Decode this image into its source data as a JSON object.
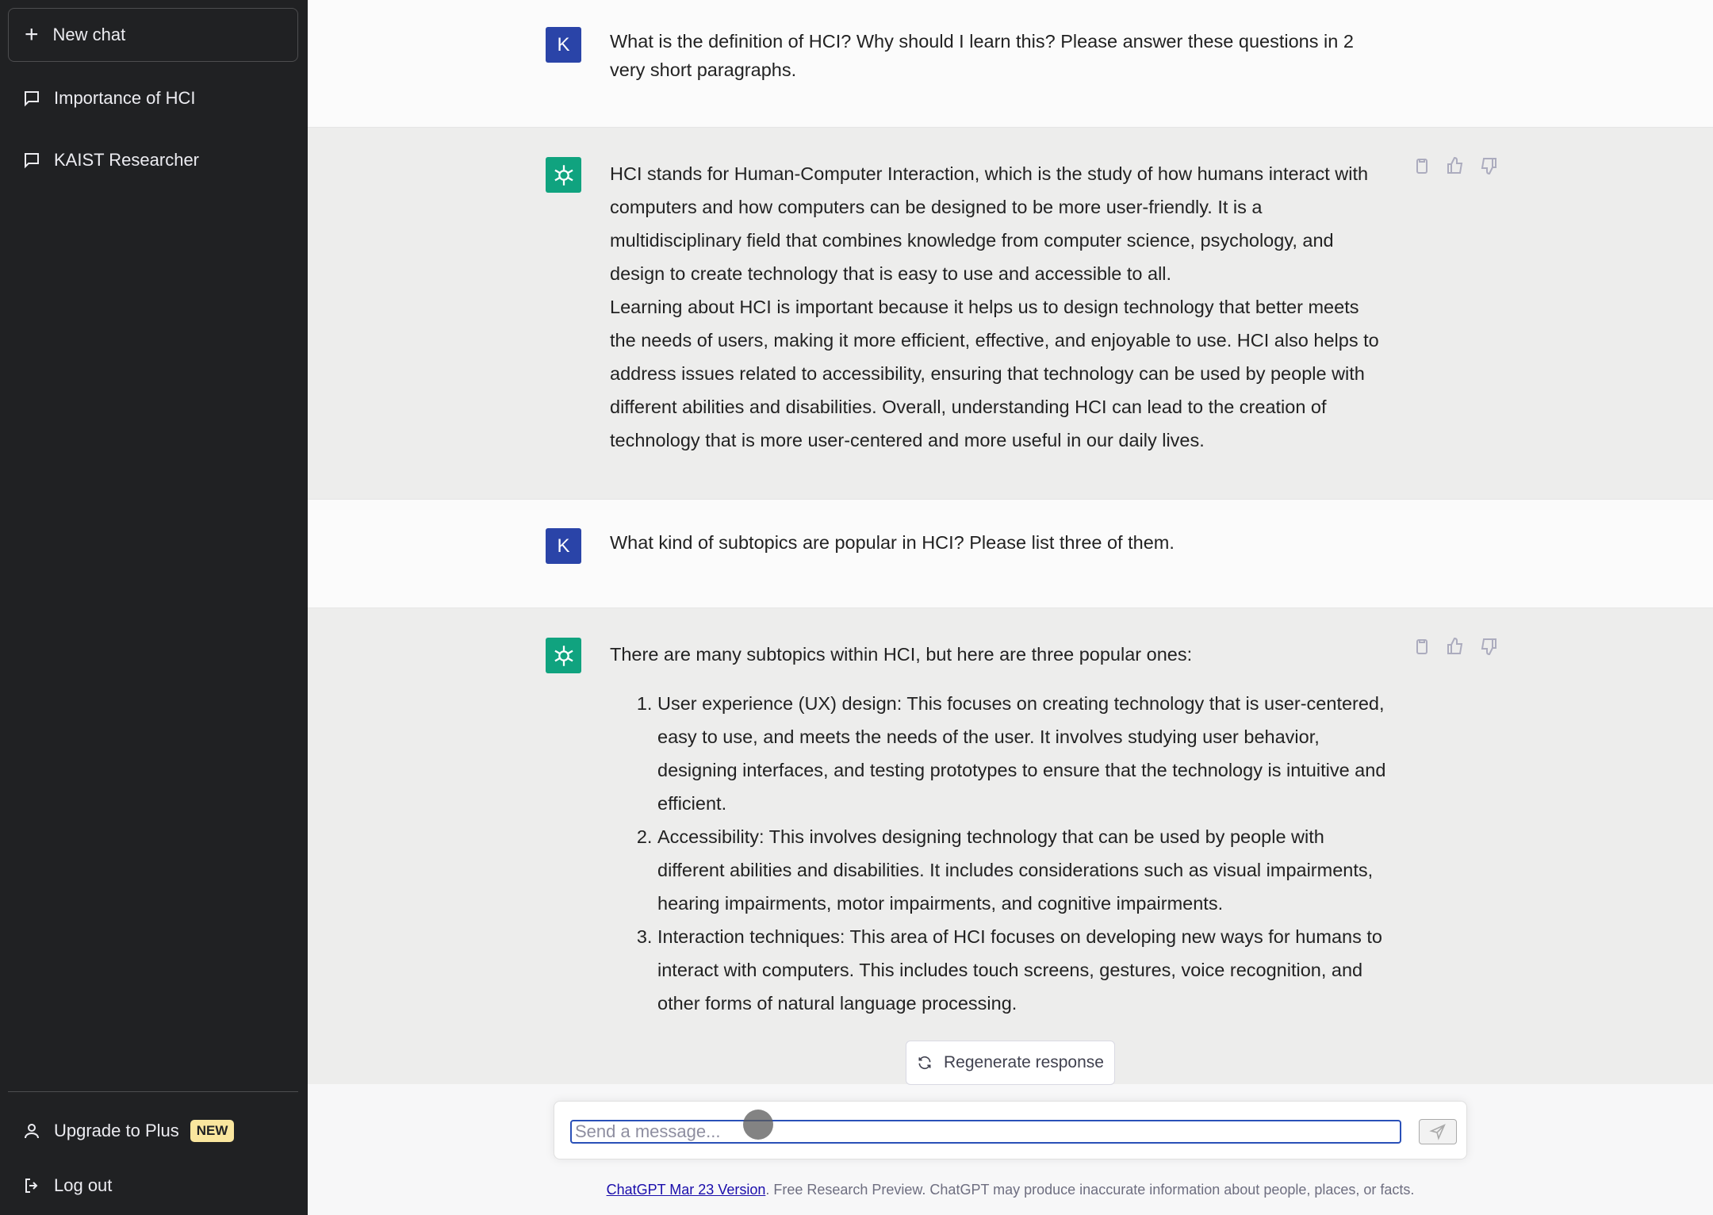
{
  "sidebar": {
    "new_chat_label": "New chat",
    "items": [
      {
        "label": "Importance of HCI"
      },
      {
        "label": "KAIST Researcher"
      }
    ],
    "upgrade_label": "Upgrade to Plus",
    "upgrade_badge": "NEW",
    "logout_label": "Log out"
  },
  "conversation": {
    "user_avatar": "K",
    "msg1": "What is the definition of HCI? Why should I learn this? Please answer these questions in 2 very short paragraphs.",
    "resp1_p1": "HCI stands for Human-Computer Interaction, which is the study of how humans interact with computers and how computers can be designed to be more user-friendly. It is a multidisciplinary field that combines knowledge from computer science, psychology, and design to create technology that is easy to use and accessible to all.",
    "resp1_p2": "Learning about HCI is important because it helps us to design technology that better meets the needs of users, making it more efficient, effective, and enjoyable to use. HCI also helps to address issues related to accessibility, ensuring that technology can be used by people with different abilities and disabilities. Overall, understanding HCI can lead to the creation of technology that is more user-centered and more useful in our daily lives.",
    "msg2": "What kind of subtopics are popular in HCI? Please list three of them.",
    "resp2_intro": "There are many subtopics within HCI, but here are three popular ones:",
    "resp2_items": [
      "User experience (UX) design: This focuses on creating technology that is user-centered, easy to use, and meets the needs of the user. It involves studying user behavior, designing interfaces, and testing prototypes to ensure that the technology is intuitive and efficient.",
      "Accessibility: This involves designing technology that can be used by people with different abilities and disabilities. It includes considerations such as visual impairments, hearing impairments, motor impairments, and cognitive impairments.",
      "Interaction techniques: This area of HCI focuses on developing new ways for humans to interact with computers. This includes touch screens, gestures, voice recognition, and other forms of natural language processing."
    ]
  },
  "regenerate_label": "Regenerate response",
  "input": {
    "placeholder": "Send a message..."
  },
  "footer": {
    "link_text": "ChatGPT Mar 23 Version",
    "text": ". Free Research Preview. ChatGPT may produce inaccurate information about people, places, or facts."
  },
  "colors": {
    "sidebar_bg": "#202123",
    "user_avatar_bg": "#2a44a8",
    "gpt_avatar_bg": "#10a37f",
    "badge_bg": "#fae69e"
  },
  "icons": [
    "plus-icon",
    "chat-bubble-icon",
    "user-icon",
    "logout-icon",
    "clipboard-icon",
    "thumbs-up-icon",
    "thumbs-down-icon",
    "refresh-icon",
    "send-icon",
    "openai-logo-icon"
  ]
}
